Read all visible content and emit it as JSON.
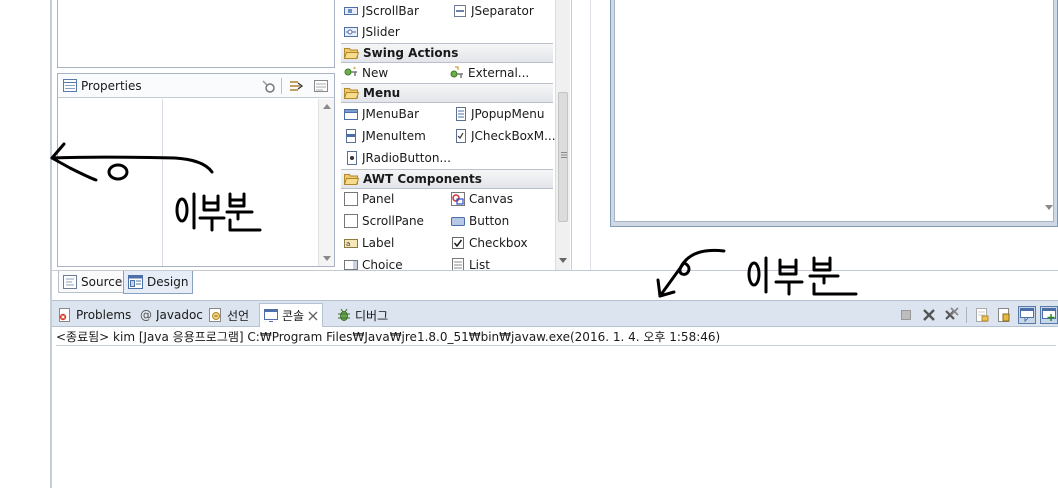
{
  "palette": {
    "items_top": [
      {
        "label": "JScrollBar",
        "icon": "jscrollbar-icon"
      },
      {
        "label": "JSeparator",
        "icon": "jseparator-icon"
      },
      {
        "label": "JSlider",
        "icon": "jslider-icon"
      }
    ],
    "swing_actions": {
      "title": "Swing Actions",
      "items": [
        {
          "label": "New",
          "icon": "new-action-icon"
        },
        {
          "label": "External...",
          "icon": "external-action-icon"
        }
      ]
    },
    "menu": {
      "title": "Menu",
      "items": [
        {
          "label": "JMenuBar",
          "icon": "jmenubar-icon"
        },
        {
          "label": "JPopupMenu",
          "icon": "jpopupmenu-icon"
        },
        {
          "label": "JMenuItem",
          "icon": "jmenuitem-icon"
        },
        {
          "label": "JCheckBoxM...",
          "icon": "jcheckboxmenuitem-icon"
        },
        {
          "label": "JRadioButton...",
          "icon": "jradiobuttonmenuitem-icon"
        }
      ]
    },
    "awt": {
      "title": "AWT Components",
      "items": [
        {
          "label": "Panel",
          "icon": "panel-icon"
        },
        {
          "label": "Canvas",
          "icon": "canvas-icon"
        },
        {
          "label": "ScrollPane",
          "icon": "scrollpane-icon"
        },
        {
          "label": "Button",
          "icon": "button-icon"
        },
        {
          "label": "Label",
          "icon": "label-icon"
        },
        {
          "label": "Checkbox",
          "icon": "checkbox-icon"
        },
        {
          "label": "Choice",
          "icon": "choice-icon"
        },
        {
          "label": "List",
          "icon": "list-icon"
        }
      ]
    }
  },
  "properties": {
    "title": "Properties"
  },
  "editor_tabs": {
    "source": "Source",
    "design": "Design"
  },
  "bottom_tabs": [
    {
      "label": "Problems",
      "icon": "problems-icon"
    },
    {
      "label": "Javadoc",
      "icon": "at-icon"
    },
    {
      "label": "선언",
      "icon": "declaration-icon"
    },
    {
      "label": "콘솔",
      "icon": "console-icon",
      "active": true
    },
    {
      "label": "디버그",
      "icon": "debug-icon"
    }
  ],
  "console": {
    "status": "<종료됨> kim [Java 응용프로그램] C:₩Program Files₩Java₩jre1.8.0_51₩bin₩javaw.exe(2016. 1. 4. 오후 1:58:46)"
  },
  "annotations": {
    "left_note": "이부분",
    "right_note": "이부분"
  },
  "colors": {
    "view_tab_bar": "#dce4ef",
    "active_tab": "#ffffff",
    "border": "#a9b3c3",
    "annotation_ink": "#000000"
  }
}
